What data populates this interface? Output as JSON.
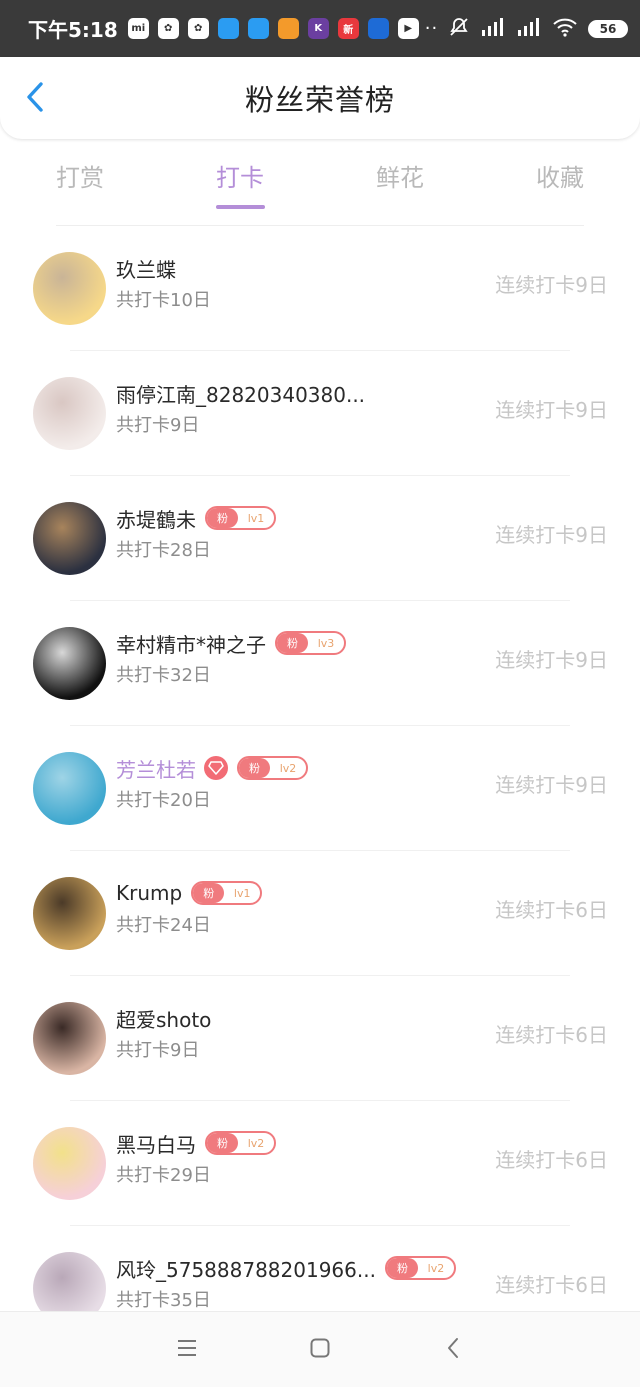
{
  "status_bar": {
    "time": "下午5:18",
    "notif_icons": [
      {
        "name": "mi-icon",
        "text": "mi",
        "color": "#ffffff"
      },
      {
        "name": "paw-icon",
        "text": "✿",
        "color": "#ffffff"
      },
      {
        "name": "paw-icon-2",
        "text": "✿",
        "color": "#ffffff"
      },
      {
        "name": "app-blue-icon",
        "text": "",
        "color": "#2b9cf2"
      },
      {
        "name": "app-blue-icon-2",
        "text": "",
        "color": "#2b9cf2"
      },
      {
        "name": "uc-icon",
        "text": "",
        "color": "#f39a2b"
      },
      {
        "name": "k-icon",
        "text": "K",
        "color": "#6b3fa0"
      },
      {
        "name": "news-icon",
        "text": "新",
        "color": "#e8383d"
      },
      {
        "name": "box-icon",
        "text": "",
        "color": "#1e6bd6"
      },
      {
        "name": "play-icon",
        "text": "▶",
        "color": "#ffffff"
      }
    ],
    "more": "··",
    "battery": "56"
  },
  "header": {
    "title": "粉丝荣誉榜"
  },
  "tabs": [
    {
      "label": "打赏",
      "active": false
    },
    {
      "label": "打卡",
      "active": true
    },
    {
      "label": "鲜花",
      "active": false
    },
    {
      "label": "收藏",
      "active": false
    }
  ],
  "fans": [
    {
      "name": "玖兰蝶",
      "total": "共打卡10日",
      "streak": "连续打卡9日",
      "vip": false,
      "badge": null,
      "avatar_colors": [
        "#f6d889",
        "#c9b497"
      ]
    },
    {
      "name": "雨停江南_82820340380...",
      "total": "共打卡9日",
      "streak": "连续打卡9日",
      "vip": false,
      "badge": null,
      "avatar_colors": [
        "#f3ecea",
        "#d9c7c3"
      ]
    },
    {
      "name": "赤堤鶴未",
      "total": "共打卡28日",
      "streak": "连续打卡9日",
      "vip": false,
      "badge": {
        "fan": "粉",
        "level": "lv1"
      },
      "avatar_colors": [
        "#2b3040",
        "#a8845c"
      ]
    },
    {
      "name": "幸村精市*神之子",
      "total": "共打卡32日",
      "streak": "连续打卡9日",
      "vip": false,
      "badge": {
        "fan": "粉",
        "level": "lv3"
      },
      "avatar_colors": [
        "#111111",
        "#d8d8d8"
      ]
    },
    {
      "name": "芳兰杜若",
      "total": "共打卡20日",
      "streak": "连续打卡9日",
      "vip": true,
      "badge": {
        "fan": "粉",
        "level": "lv2"
      },
      "avatar_colors": [
        "#3fa8cf",
        "#9fd4e6"
      ]
    },
    {
      "name": "Krump",
      "total": "共打卡24日",
      "streak": "连续打卡6日",
      "vip": false,
      "badge": {
        "fan": "粉",
        "level": "lv1"
      },
      "avatar_colors": [
        "#c9a05a",
        "#4b3a28"
      ]
    },
    {
      "name": "超爱shoto",
      "total": "共打卡9日",
      "streak": "连续打卡6日",
      "vip": false,
      "badge": null,
      "avatar_colors": [
        "#d9b5a4",
        "#3a2a26"
      ]
    },
    {
      "name": "黑马白马",
      "total": "共打卡29日",
      "streak": "连续打卡6日",
      "vip": false,
      "badge": {
        "fan": "粉",
        "level": "lv2"
      },
      "avatar_colors": [
        "#f6d0d8",
        "#f2e18a"
      ]
    },
    {
      "name": "风玲_575888788201966...",
      "total": "共打卡35日",
      "streak": "连续打卡6日",
      "vip": false,
      "badge": {
        "fan": "粉",
        "level": "lv2"
      },
      "avatar_colors": [
        "#e7dde6",
        "#b9a8b8"
      ]
    }
  ],
  "colors": {
    "accent": "#b48ed8",
    "badge": "#f07a7e",
    "badge_level": "#e8a36e",
    "status_bar": "#3a3a3a"
  }
}
